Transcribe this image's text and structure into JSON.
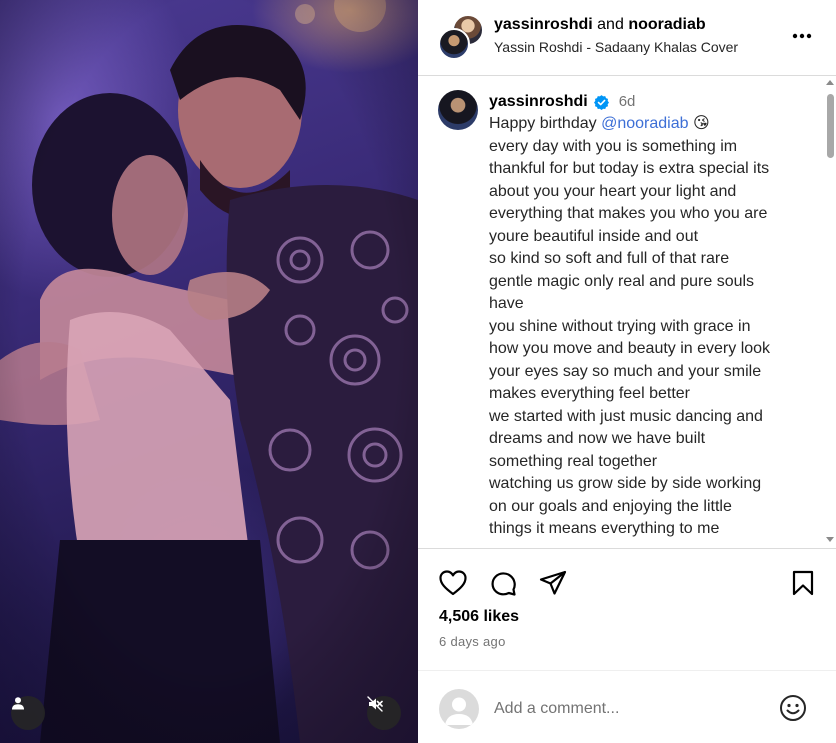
{
  "header": {
    "user1": "yassinroshdi",
    "joiner": "and",
    "user2": "nooradiab",
    "audio": "Yassin Roshdi - Sadaany Khalas Cover",
    "more_icon": "more-horizontal-icon"
  },
  "caption": {
    "username": "yassinroshdi",
    "verified": true,
    "time": "6d",
    "greeting": "Happy birthday",
    "mention": "@nooradiab",
    "emoji": "😘",
    "lines": [
      "every day with you is something im",
      "thankful for but today is extra special its",
      "about you your heart your light and",
      "everything that makes you who you are",
      "youre beautiful inside and out",
      "so kind so soft and full of that rare",
      "gentle magic only real and pure souls",
      "have",
      "you shine without trying with grace in",
      "how you move and beauty in every look",
      "your eyes say so much and your smile",
      "makes everything feel better",
      "we started with just music dancing and",
      "dreams and now we have built",
      "something real together",
      "watching us grow side by side working",
      "on our goals and enjoying the little",
      "things it means everything to me"
    ]
  },
  "actions": {
    "like_icon": "heart-icon",
    "comment_icon": "comment-icon",
    "share_icon": "share-icon",
    "save_icon": "bookmark-icon"
  },
  "stats": {
    "likes": "4,506 likes",
    "posted": "6 days ago"
  },
  "add_comment": {
    "placeholder": "Add a comment...",
    "emoji_icon": "emoji-icon"
  },
  "media": {
    "tag_icon": "user-tag-icon",
    "mute_icon": "muted-speaker-icon"
  },
  "colors": {
    "mention": "#3d6fd6",
    "verified": "#0095f6",
    "muted_text": "#737373",
    "border": "#dbdbdb"
  }
}
